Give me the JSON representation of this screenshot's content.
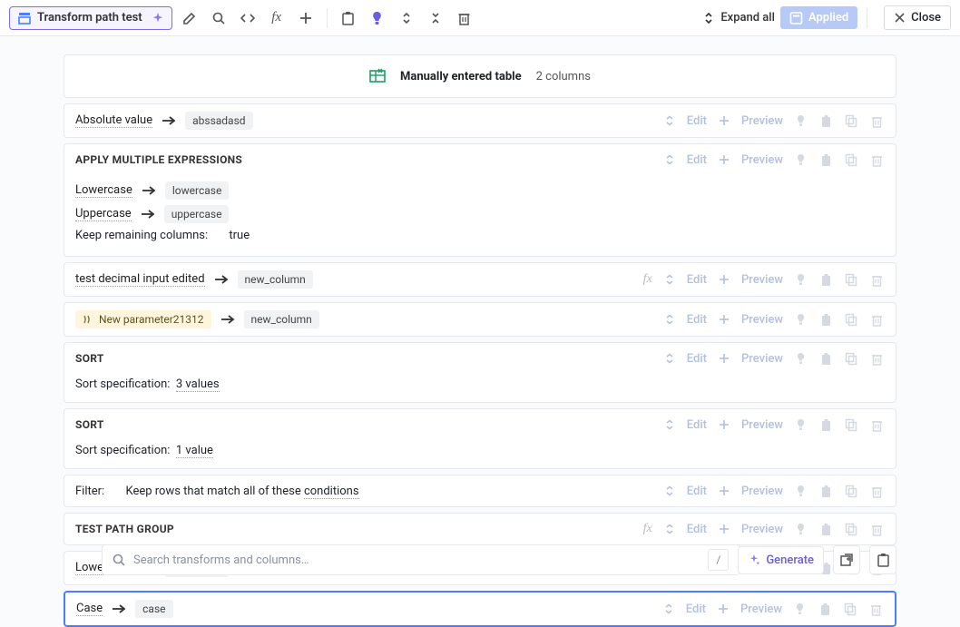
{
  "toolbar": {
    "title": "Transform path test",
    "expand_all": "Expand all",
    "applied": "Applied",
    "close": "Close"
  },
  "source": {
    "title": "Manually entered table",
    "meta": "2 columns"
  },
  "steps": [
    {
      "kind": "simple",
      "name": "Absolute value",
      "chip": "abssadasd"
    },
    {
      "kind": "group",
      "title": "APPLY MULTIPLE EXPRESSIONS",
      "rows": [
        {
          "name": "Lowercase",
          "chip": "lowercase"
        },
        {
          "name": "Uppercase",
          "chip": "uppercase"
        }
      ],
      "extra_label": "Keep remaining columns:",
      "extra_value": "true"
    },
    {
      "kind": "simple",
      "name": "test decimal input edited",
      "chip": "new_column",
      "fx": true
    },
    {
      "kind": "param",
      "name": "New parameter21312",
      "chip": "new_column"
    },
    {
      "kind": "sort",
      "title": "SORT",
      "spec_label": "Sort specification:",
      "spec_value": "3 values"
    },
    {
      "kind": "sort",
      "title": "SORT",
      "spec_label": "Sort specification:",
      "spec_value": "1 value"
    },
    {
      "kind": "filter",
      "label": "Filter:",
      "text_a": "Keep rows that match all of these ",
      "text_b": "conditions"
    },
    {
      "kind": "titleonly",
      "title": "TEST PATH GROUP",
      "fx": true
    },
    {
      "kind": "simple",
      "name": "Lowercase",
      "chip": "lowercase"
    },
    {
      "kind": "simple",
      "name": "Case",
      "chip": "case",
      "selected": true
    }
  ],
  "actions": {
    "edit": "Edit",
    "preview": "Preview"
  },
  "search": {
    "placeholder": "Search transforms and columns…",
    "slash": "/",
    "generate": "Generate"
  }
}
